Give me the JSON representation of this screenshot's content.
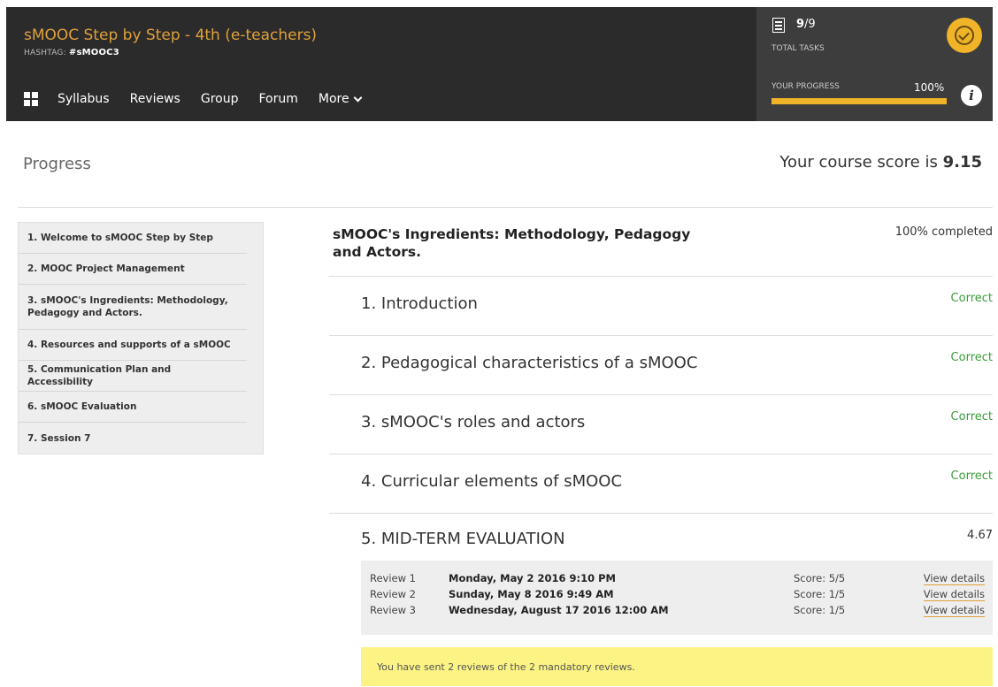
{
  "header": {
    "course_title": "sMOOC Step by Step - 4th (e-teachers)",
    "hashtag_prefix": "HASHTAG: ",
    "hashtag": "#sMOOC3",
    "nav": [
      "Syllabus",
      "Reviews",
      "Group",
      "Forum",
      "More"
    ],
    "tasks_done": "9",
    "tasks_total": "/9",
    "tasks_label": "TOTAL TASKS",
    "progress_label": "YOUR PROGRESS",
    "progress_value": "100%",
    "progress_fraction": 1.0,
    "accent_color": "#f0b428"
  },
  "page": {
    "title": "Progress",
    "score_prefix": "Your course score is ",
    "score": "9.15"
  },
  "sidebar": {
    "items": [
      "1. Welcome to sMOOC Step by Step",
      "2. MOOC Project Management",
      "3. sMOOC's Ingredients: Methodology, Pedagogy and Actors.",
      "4. Resources and supports of a sMOOC",
      "5. Communication Plan and Accessibility",
      "6. sMOOC Evaluation",
      "7. Session 7"
    ]
  },
  "unit": {
    "title": "sMOOC's Ingredients: Methodology, Pedagogy and Actors.",
    "completed": "100% completed",
    "lessons": [
      {
        "title": "1. Introduction",
        "status": "Correct"
      },
      {
        "title": "2. Pedagogical characteristics of a sMOOC",
        "status": "Correct"
      },
      {
        "title": "3. sMOOC's roles and actors",
        "status": "Correct"
      },
      {
        "title": "4. Curricular elements of sMOOC",
        "status": "Correct"
      }
    ],
    "evaluation": {
      "title": "5. MID-TERM EVALUATION",
      "score": "4.67",
      "reviews": [
        {
          "name": "Review 1",
          "date": "Monday, May 2 2016 9:10 PM",
          "score": "Score: 5/5",
          "link": "View details"
        },
        {
          "name": "Review 2",
          "date": "Sunday, May 8 2016 9:49 AM",
          "score": "Score: 1/5",
          "link": "View details"
        },
        {
          "name": "Review 3",
          "date": "Wednesday, August 17 2016 12:00 AM",
          "score": "Score: 1/5",
          "link": "View details"
        }
      ],
      "notice": "You have sent 2 reviews of the 2 mandatory reviews."
    }
  }
}
